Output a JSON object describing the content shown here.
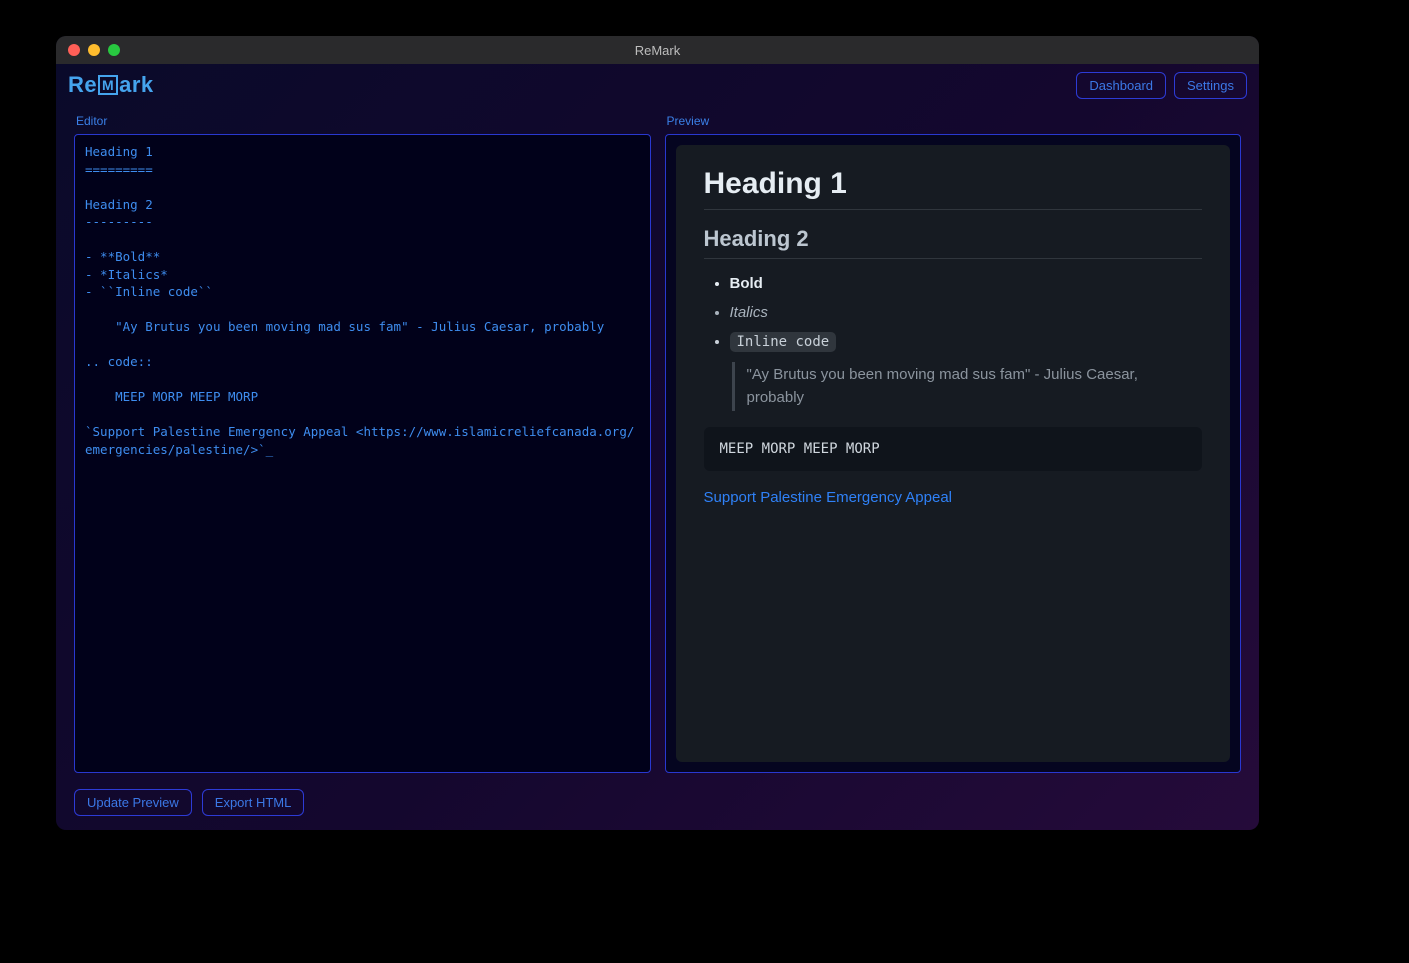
{
  "window": {
    "title": "ReMark"
  },
  "logo": {
    "prefix": "Re",
    "boxed": "M",
    "suffix": "ark"
  },
  "top_buttons": {
    "dashboard": "Dashboard",
    "settings": "Settings"
  },
  "panes": {
    "editor_label": "Editor",
    "preview_label": "Preview"
  },
  "editor_content": "Heading 1\n=========\n\nHeading 2\n---------\n\n- **Bold**\n- *Italics*\n- ``Inline code``\n\n    \"Ay Brutus you been moving mad sus fam\" - Julius Caesar, probably\n\n.. code::\n\n    MEEP MORP MEEP MORP\n\n`Support Palestine Emergency Appeal <https://www.islamicreliefcanada.org/emergencies/palestine/>`_",
  "preview": {
    "h1": "Heading 1",
    "h2": "Heading 2",
    "li_bold": "Bold",
    "li_italic": "Italics",
    "li_code": "Inline code",
    "quote": "\"Ay Brutus you been moving mad sus fam\" - Julius Caesar, probably",
    "codeblock": "MEEP MORP MEEP MORP",
    "link_text": "Support Palestine Emergency Appeal"
  },
  "bottom_buttons": {
    "update": "Update Preview",
    "export": "Export HTML"
  }
}
